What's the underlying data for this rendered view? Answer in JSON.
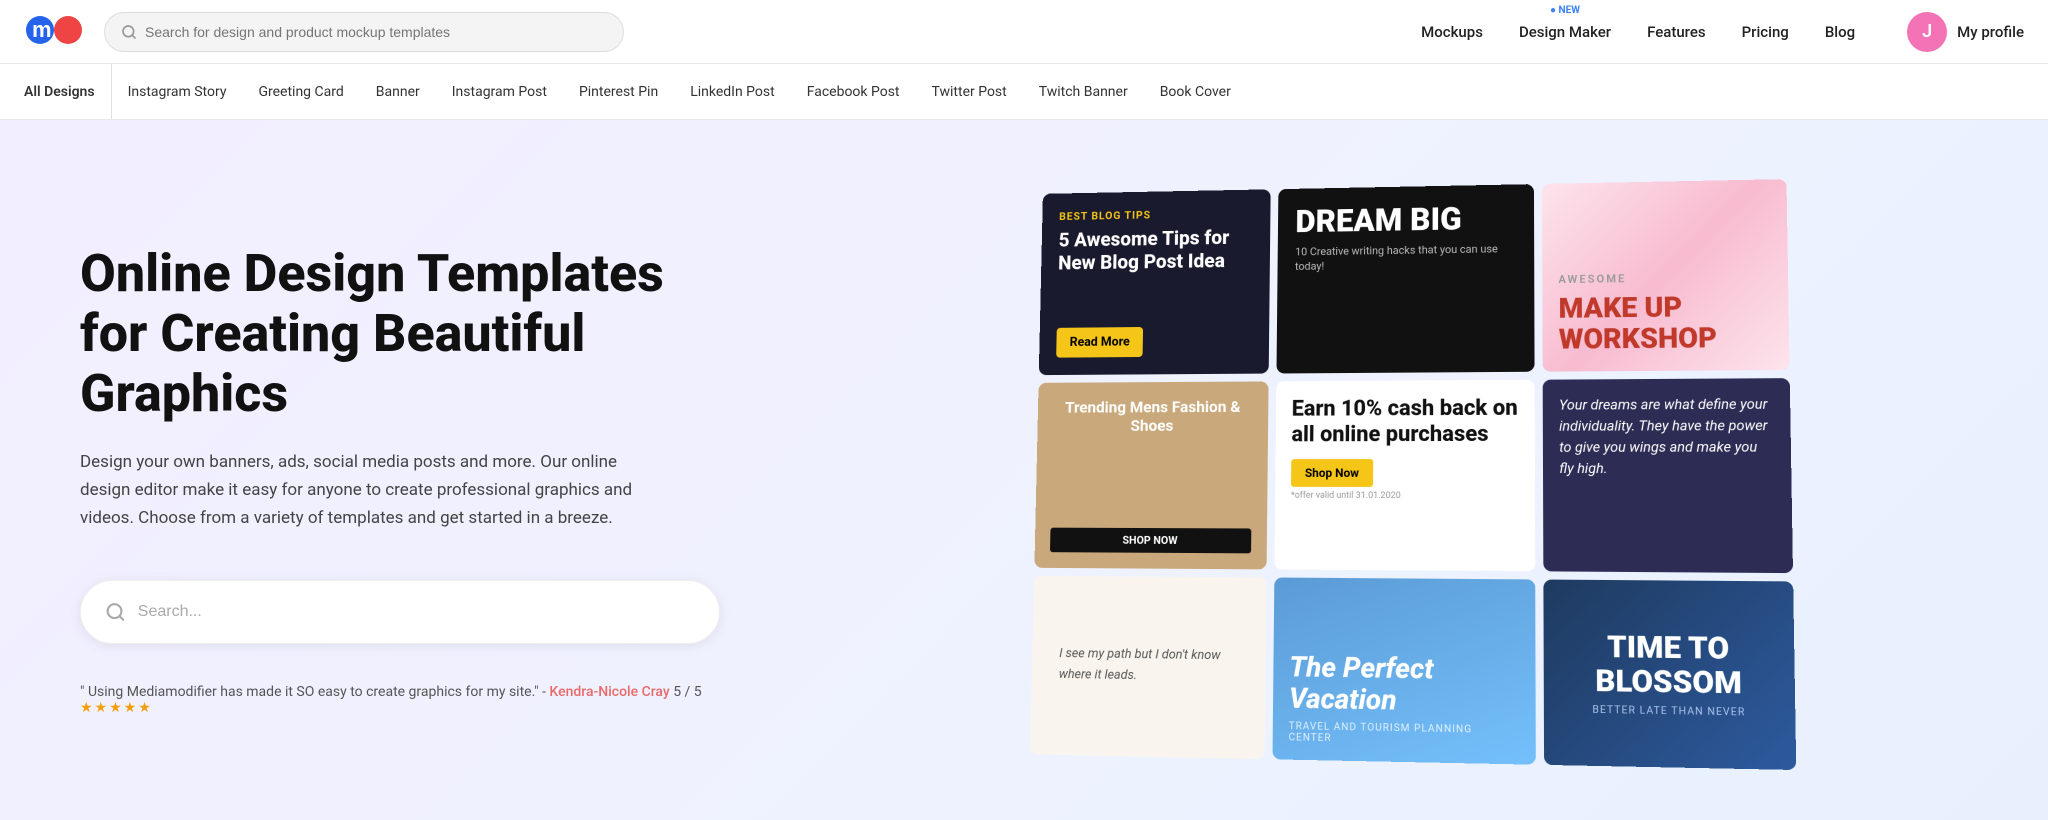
{
  "header": {
    "logo_text": "m",
    "search_placeholder": "Search for design and product mockup templates",
    "nav_items": [
      {
        "id": "mockups",
        "label": "Mockups",
        "badge": false
      },
      {
        "id": "design-maker",
        "label": "Design Maker",
        "badge": true
      },
      {
        "id": "features",
        "label": "Features",
        "badge": false
      },
      {
        "id": "pricing",
        "label": "Pricing",
        "badge": false
      },
      {
        "id": "blog",
        "label": "Blog",
        "badge": false
      }
    ],
    "profile": {
      "initial": "J",
      "name": "My profile"
    }
  },
  "sub_nav": {
    "items": [
      {
        "id": "all-designs",
        "label": "All Designs"
      },
      {
        "id": "instagram-story",
        "label": "Instagram Story"
      },
      {
        "id": "greeting-card",
        "label": "Greeting Card"
      },
      {
        "id": "banner",
        "label": "Banner"
      },
      {
        "id": "instagram-post",
        "label": "Instagram Post"
      },
      {
        "id": "pinterest-pin",
        "label": "Pinterest Pin"
      },
      {
        "id": "linkedin-post",
        "label": "LinkedIn Post"
      },
      {
        "id": "facebook-post",
        "label": "Facebook Post"
      },
      {
        "id": "twitter-post",
        "label": "Twitter Post"
      },
      {
        "id": "twitch-banner",
        "label": "Twitch Banner"
      },
      {
        "id": "book-cover",
        "label": "Book Cover"
      }
    ]
  },
  "hero": {
    "title": "Online Design Templates for Creating Beautiful Graphics",
    "description": "Design your own banners, ads, social media posts and more. Our online design editor make it easy for anyone to create professional graphics and videos. Choose from a variety of templates and get started in a breeze.",
    "search_placeholder": "Search...",
    "testimonial": {
      "quote": "\" Using Mediamodifier has made it SO easy to create graphics for my site.\" -",
      "author": "Kendra-Nicole Cray",
      "rating": "5 / 5",
      "stars": "★★★★★"
    }
  },
  "mosaic": {
    "tiles": [
      {
        "id": "t1",
        "type": "blog-tips",
        "headline": "5 Awesome Tips for New Blog Post Idea",
        "button": "Read More"
      },
      {
        "id": "t2",
        "type": "dream-big",
        "headline": "DREAM BIG",
        "subtext": "10 Creative writing hacks that you can use today!"
      },
      {
        "id": "t3",
        "type": "makeup",
        "headline": "MAKE UP WORKSHOP"
      },
      {
        "id": "t4",
        "type": "fashion",
        "headline": "Trending Mens Fashion & Shoes",
        "button": "SHOP NOW"
      },
      {
        "id": "t5",
        "type": "cashback",
        "headline": "Earn 10% cash back on all online purchases",
        "button": "Shop Now",
        "note": "*offer valid until 31.01.2020"
      },
      {
        "id": "t6",
        "type": "quote",
        "text": "Your dreams are what define your individuality. They have the power to give you wings and make you fly high."
      },
      {
        "id": "t7",
        "type": "path",
        "text": "I see my path but I don't know where it leads."
      },
      {
        "id": "t8",
        "type": "vacation",
        "headline": "The Perfect Vacation",
        "sub": "TRAVEL AND TOURISM PLANNING CENTER"
      },
      {
        "id": "t9",
        "type": "blossom",
        "headline": "TIME TO BLOSSOM",
        "sub": "BETTER LATE THAN NEVER"
      }
    ]
  }
}
